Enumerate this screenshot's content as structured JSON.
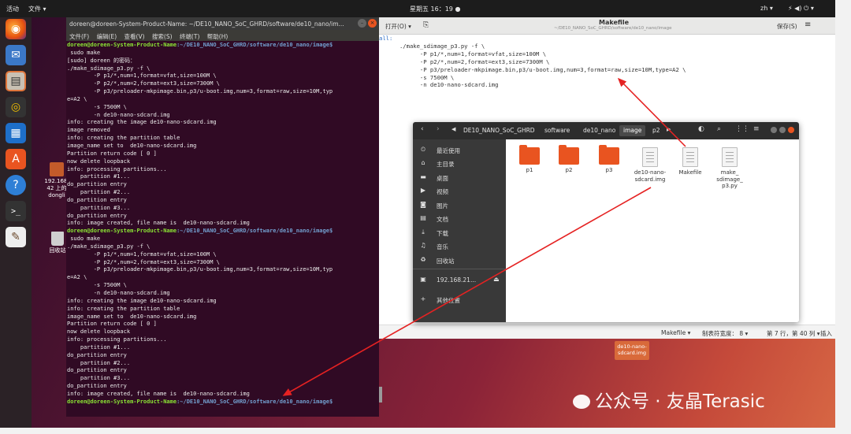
{
  "topbar": {
    "activities": "活动",
    "file_menu": "文件 ▾",
    "clock": "星期五 16：19 ●",
    "lang": "zh ▾",
    "sys_icons": "⚡ ◀) ⏻ ▾"
  },
  "desktop": {
    "items": [
      {
        "label_line1": "192.168.",
        "label_line2": "42 上的",
        "label_line3": "dongli"
      },
      {
        "label_line1": "回收站"
      }
    ],
    "bottom_file": {
      "line1": "de10-nano-",
      "line2": "sdcard.img"
    }
  },
  "terminal": {
    "title": "doreen@doreen-System-Product-Name: ~/DE10_NANO_SoC_GHRD/software/de10_nano/im...",
    "menu": [
      "文件(F)",
      "编辑(E)",
      "查看(V)",
      "搜索(S)",
      "终端(T)",
      "帮助(H)"
    ],
    "prompt_user": "doreen@doreen-System-Product-Name",
    "prompt_path": ":~/DE10_NANO_SoC_GHRD/software/de10_nano/image$",
    "lines": [
      " sudo make",
      "[sudo] doreen 的密码：",
      "./make_sdimage_p3.py -f \\",
      "        -P p1/*,num=1,format=vfat,size=100M \\",
      "        -P p2/*,num=2,format=ext3,size=7300M \\",
      "        -P p3/preloader-mkpimage.bin,p3/u-boot.img,num=3,format=raw,size=10M,typ",
      "e=A2 \\",
      "        -s 7500M \\",
      "        -n de10-nano-sdcard.img",
      "info: creating the image de10-nano-sdcard.img",
      "image removed",
      "info: creating the partition table",
      "image_name set to  de10-nano-sdcard.img",
      "Partition return code [ 0 ]",
      "now delete loopback",
      "info: processing partitions...",
      "    partition #1...",
      "do_partition entry",
      "    partition #2...",
      "do_partition entry",
      "    partition #3...",
      "do_partition entry",
      "info: image created, file name is  de10-nano-sdcard.img"
    ],
    "lines2": [
      " sudo make",
      "./make_sdimage_p3.py -f \\",
      "        -P p1/*,num=1,format=vfat,size=100M \\",
      "        -P p2/*,num=2,format=ext3,size=7300M \\",
      "        -P p3/preloader-mkpimage.bin,p3/u-boot.img,num=3,format=raw,size=10M,typ",
      "e=A2 \\",
      "        -s 7500M \\",
      "        -n de10-nano-sdcard.img",
      "info: creating the image de10-nano-sdcard.img",
      "info: creating the partition table",
      "image_name set to  de10-nano-sdcard.img",
      "Partition return code [ 0 ]",
      "now delete loopback",
      "info: processing partitions...",
      "    partition #1...",
      "do_partition entry",
      "    partition #2...",
      "do_partition entry",
      "    partition #3...",
      "do_partition entry",
      "info: image created, file name is  de10-nano-sdcard.img"
    ]
  },
  "editor": {
    "open_label": "打开(O) ▾",
    "title": "Makefile",
    "subtitle": "~/DE10_NANO_SoC_GHRD/software/de10_nano/image",
    "save_label": "保存(S)",
    "menu_icon": "≡",
    "code": [
      "all:",
      "\t./make_sdimage_p3.py -f \\",
      "\t\t-P p1/*,num=1,format=vfat,size=100M \\",
      "\t\t-P p2/*,num=2,format=ext3,size=7300M \\",
      "\t\t-P p3/preloader-mkpimage.bin,p3/u-boot.img,num=3,format=raw,size=10M,type=A2 \\",
      "\t\t-s 7500M \\",
      "\t\t-n de10-nano-sdcard.img"
    ],
    "status_lang": "Makefile ▾",
    "status_tab": "制表符宽度： 8 ▾",
    "status_pos": "第 7 行，第 40 列 ▾",
    "status_ins": "插入"
  },
  "files": {
    "breadcrumbs": [
      "DE10_NANO_SoC_GHRD",
      "software",
      "de10_nano",
      "image",
      "p2"
    ],
    "sidebar": [
      {
        "icon": "⏲",
        "label": "最近使用"
      },
      {
        "icon": "⌂",
        "label": "主目录"
      },
      {
        "icon": "▬",
        "label": "桌面"
      },
      {
        "icon": "▶",
        "label": "视频"
      },
      {
        "icon": "◙",
        "label": "图片"
      },
      {
        "icon": "▤",
        "label": "文档"
      },
      {
        "icon": "⤓",
        "label": "下载"
      },
      {
        "icon": "♫",
        "label": "音乐"
      },
      {
        "icon": "♻",
        "label": "回收站"
      },
      {
        "icon": "▣",
        "label": "192.168.21..."
      },
      {
        "icon": "+",
        "label": "其他位置"
      }
    ],
    "items": [
      {
        "name": "p1",
        "kind": "folder"
      },
      {
        "name": "p2",
        "kind": "folder"
      },
      {
        "name": "p3",
        "kind": "folder"
      },
      {
        "name": "de10-nano-sdcard.img",
        "kind": "file",
        "line1": "de10-nano-",
        "line2": "sdcard.img"
      },
      {
        "name": "Makefile",
        "kind": "file"
      },
      {
        "name": "make_sdimage_p3.py",
        "kind": "file",
        "line1": "make_",
        "line2": "sdimage_",
        "line3": "p3.py"
      }
    ]
  },
  "watermark": "公众号 · 友晶Terasic",
  "colors": {
    "terminal_bg": "#300a24",
    "prompt_green": "#8ae234",
    "prompt_blue": "#729fcf",
    "ubuntu_orange": "#e95420",
    "arrow_red": "#e52222"
  }
}
